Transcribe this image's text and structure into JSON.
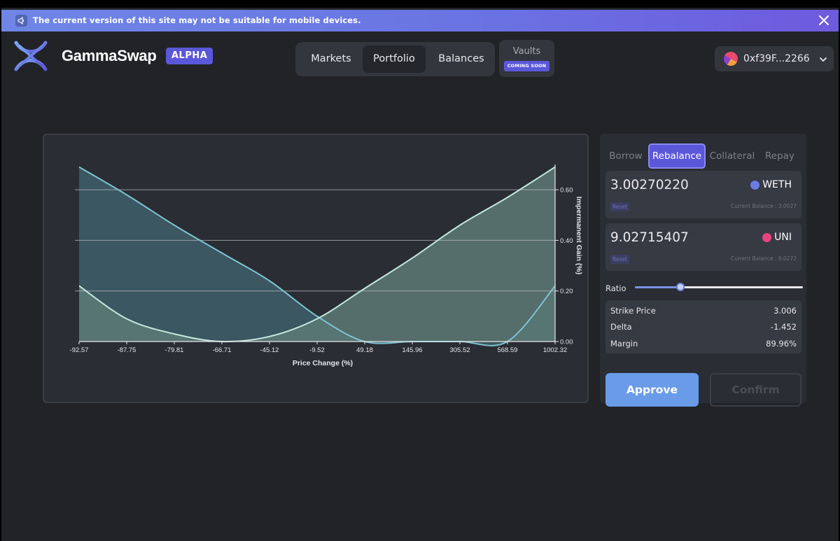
{
  "banner": {
    "text": "The current version of this site may not be suitable for mobile devices."
  },
  "brand": {
    "name": "GammaSwap",
    "badge": "ALPHA"
  },
  "nav": {
    "items": [
      {
        "label": "Markets",
        "active": false
      },
      {
        "label": "Portfolio",
        "active": true
      },
      {
        "label": "Balances",
        "active": false
      }
    ],
    "vaults": {
      "label": "Vaults",
      "badge": "COMING SOON"
    }
  },
  "wallet": {
    "address": "0xf39F...2266"
  },
  "chart_data": {
    "type": "area",
    "title": "",
    "xlabel": "Price Change (%)",
    "ylabel": "Impermanent Gain (%)",
    "x_ticks": [
      "-92.57",
      "-87.75",
      "-79.81",
      "-66.71",
      "-45.12",
      "-9.52",
      "49.18",
      "145.96",
      "305.52",
      "568.59",
      "1002.32"
    ],
    "y_ticks": [
      "0.00",
      "0.20",
      "0.40",
      "0.60"
    ],
    "ylim": [
      0,
      0.7
    ],
    "grid": "horizontal",
    "y_axis_position": "right",
    "series": [
      {
        "color": "#7fc4d3",
        "fill": "#3e5f6a",
        "values": [
          0.69,
          0.58,
          0.46,
          0.35,
          0.24,
          0.1,
          0.0,
          0.0,
          0.0,
          0.0,
          0.22
        ]
      },
      {
        "color": "#c3e9de",
        "fill": "#5d7a76",
        "values": [
          0.22,
          0.09,
          0.03,
          0.0,
          0.02,
          0.09,
          0.21,
          0.33,
          0.46,
          0.57,
          0.69
        ]
      }
    ]
  },
  "panel": {
    "tabs": [
      {
        "label": "Borrow",
        "active": false
      },
      {
        "label": "Rebalance",
        "active": true
      },
      {
        "label": "Collateral",
        "active": false
      },
      {
        "label": "Repay",
        "active": false
      }
    ],
    "tokens": [
      {
        "amount": "3.00270220",
        "symbol": "WETH",
        "color": "#6a7ce6",
        "reset": "Reset",
        "balance": "Current Balance : 3.0027"
      },
      {
        "amount": "9.02715407",
        "symbol": "UNI",
        "color": "#e8457e",
        "reset": "Reset",
        "balance": "Current Balance : 9.0272"
      }
    ],
    "ratio": {
      "label": "Ratio",
      "value_fraction": 0.27
    },
    "info": [
      {
        "key": "Strike Price",
        "value": "3.006"
      },
      {
        "key": "Delta",
        "value": "-1.452"
      },
      {
        "key": "Margin",
        "value": "89.96%"
      }
    ],
    "approve": "Approve",
    "confirm": "Confirm"
  },
  "colors": {
    "accent": "#5b57d9",
    "button": "#6a9be8",
    "background": "#212327",
    "card": "#2a2d33"
  }
}
